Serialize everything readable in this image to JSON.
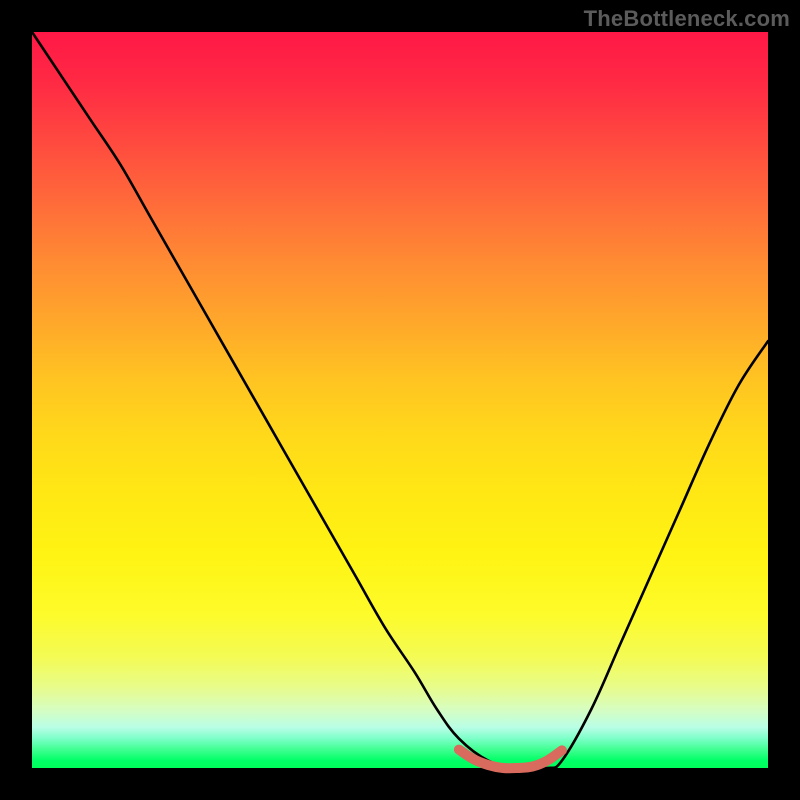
{
  "watermark": "TheBottleneck.com",
  "chart_data": {
    "type": "line",
    "title": "",
    "xlabel": "",
    "ylabel": "",
    "xlim": [
      0,
      100
    ],
    "ylim": [
      0,
      100
    ],
    "grid": false,
    "legend": false,
    "series": [
      {
        "name": "black-curve",
        "color": "#000000",
        "x": [
          0,
          4,
          8,
          12,
          16,
          20,
          24,
          28,
          32,
          36,
          40,
          44,
          48,
          52,
          55,
          58,
          62,
          66,
          70,
          72,
          76,
          80,
          84,
          88,
          92,
          96,
          100
        ],
        "values": [
          100,
          94,
          88,
          82,
          75,
          68,
          61,
          54,
          47,
          40,
          33,
          26,
          19,
          13,
          8,
          4,
          1,
          0,
          0,
          1,
          8,
          17,
          26,
          35,
          44,
          52,
          58
        ]
      },
      {
        "name": "red-bottom-segment",
        "color": "#d86a5e",
        "x": [
          58,
          60,
          62,
          64,
          66,
          68,
          70,
          72
        ],
        "values": [
          2.5,
          1.2,
          0.4,
          0.0,
          0.0,
          0.2,
          1.0,
          2.4
        ]
      }
    ],
    "background_gradient": {
      "top": "#ff1846",
      "mid": "#ffe814",
      "bottom": "#00ff5a"
    }
  }
}
